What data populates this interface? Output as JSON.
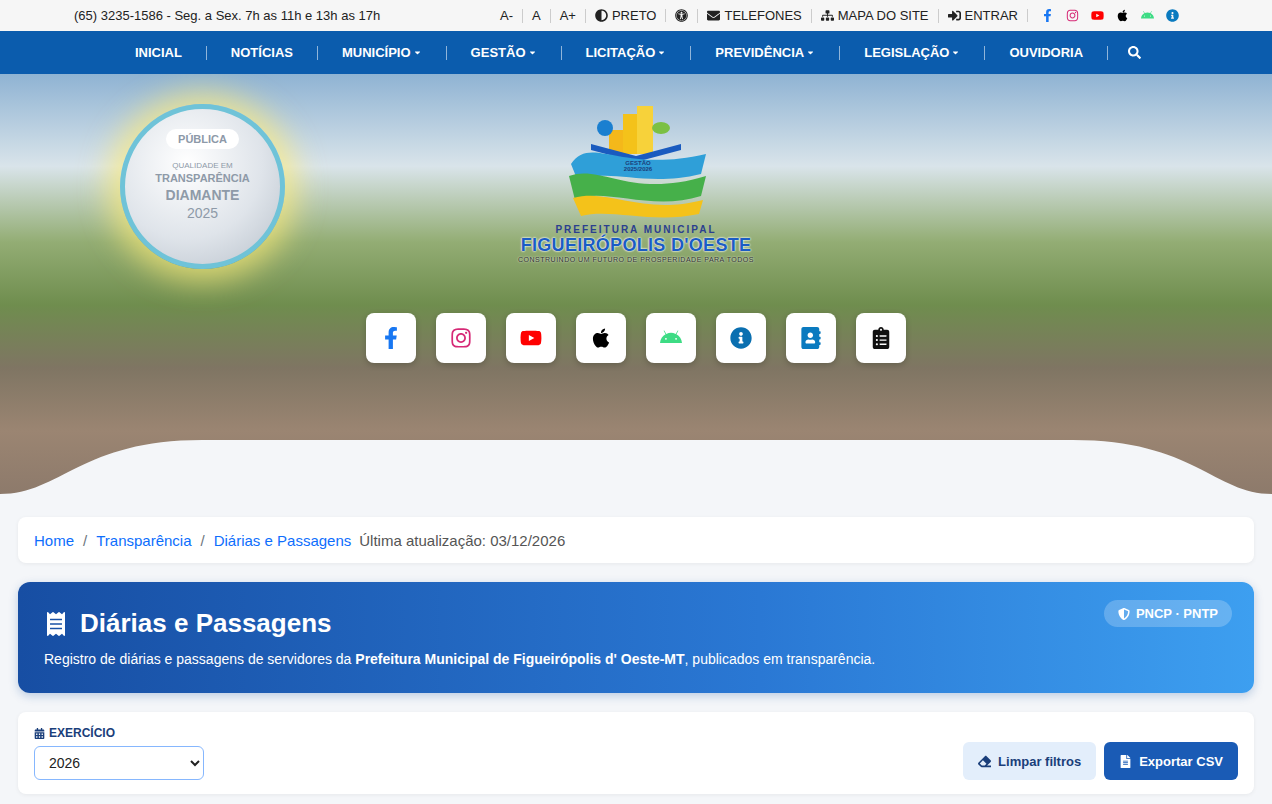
{
  "top_bar": {
    "phone": "(65) 3235-1586 - Seg. a Sex. 7h as 11h e 13h as 17h",
    "font_controls": [
      "A-",
      "A",
      "A+"
    ],
    "contrast_label": "PRETO",
    "links": [
      "TELEFONES",
      "MAPA DO SITE",
      "ENTRAR"
    ]
  },
  "nav": {
    "items": [
      {
        "label": "INICIAL",
        "dropdown": false
      },
      {
        "label": "NOTÍCIAS",
        "dropdown": false
      },
      {
        "label": "MUNICÍPIO",
        "dropdown": true
      },
      {
        "label": "GESTÃO",
        "dropdown": true
      },
      {
        "label": "LICITAÇÃO",
        "dropdown": true
      },
      {
        "label": "PREVIDÊNCIA",
        "dropdown": true
      },
      {
        "label": "LEGISLAÇÃO",
        "dropdown": true
      },
      {
        "label": "OUVIDORIA",
        "dropdown": false
      }
    ]
  },
  "hero": {
    "seal": {
      "top": "PÚBLICA",
      "line1": "QUALIDADE EM",
      "line2": "TRANSPARÊNCIA",
      "line3": "DIAMANTE",
      "year": "2025"
    },
    "logo": {
      "term": "GESTÃO 2025/2026",
      "name_top": "PREFEITURA MUNICIPAL",
      "name": "FIGUEIRÓPOLIS D'OESTE",
      "tagline": "CONSTRUINDO UM FUTURO DE PROSPERIDADE PARA TODOS"
    }
  },
  "breadcrumb": {
    "items": [
      "Home",
      "Transparência",
      "Diárias e Passagens"
    ],
    "separator": "/",
    "updated": "Última atualização: 03/12/2026"
  },
  "header": {
    "title": "Diárias e Passagens",
    "description_before": "Registro de diárias e passagens de servidores da ",
    "entity": "Prefeitura Municipal de Figueirópolis d' Oeste-MT",
    "description_after": ", publicados em transparência.",
    "badge": "PNCP · PNTP"
  },
  "filters": {
    "label": "EXERCÍCIO",
    "year": "2026"
  },
  "buttons": [
    "Limpar filtros",
    "Exportar CSV"
  ]
}
